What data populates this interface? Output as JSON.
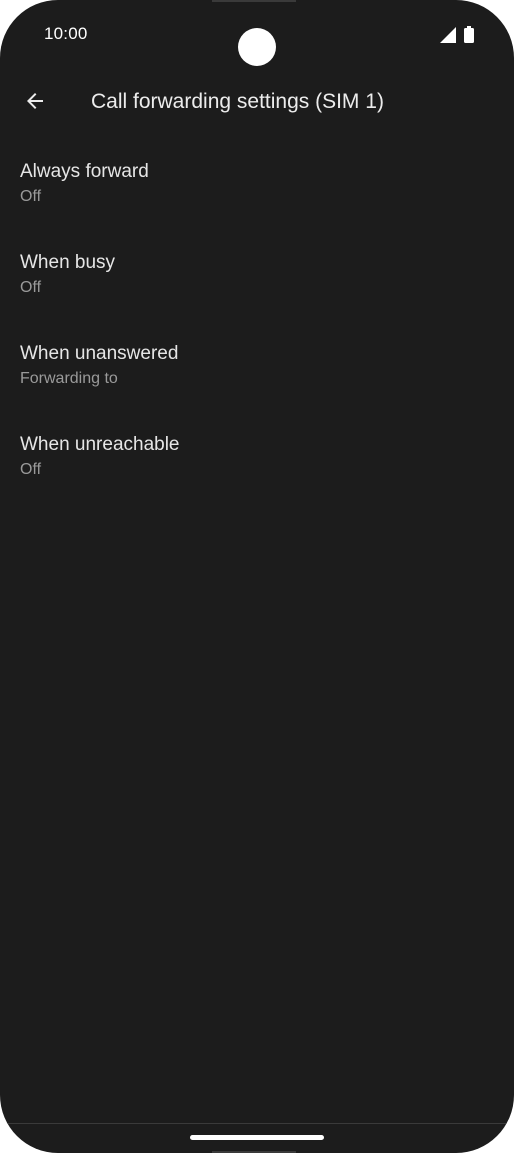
{
  "status_bar": {
    "time": "10:00",
    "icons": [
      "signal-icon",
      "battery-icon"
    ]
  },
  "app_bar": {
    "back_icon": "arrow-back-icon",
    "title": "Call forwarding settings (SIM 1)"
  },
  "settings": [
    {
      "title": "Always forward",
      "summary": "Off"
    },
    {
      "title": "When busy",
      "summary": "Off"
    },
    {
      "title": "When unanswered",
      "summary": "Forwarding to"
    },
    {
      "title": "When unreachable",
      "summary": "Off"
    }
  ],
  "colors": {
    "background": "#1c1c1c",
    "title_text": "#e6e6e6",
    "summary_text": "#9a9a9a"
  }
}
